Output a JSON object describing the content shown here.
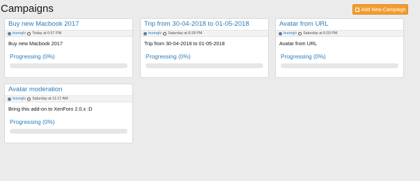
{
  "page": {
    "title": "Campaigns",
    "add_button_label": "Add New Campaign"
  },
  "campaigns": [
    {
      "title": "Buy new Macbook 2017",
      "user": "truonglv",
      "time": "Today at 6:57 PM",
      "description": "Buy new Macbook 2017",
      "progress_label": "Progressing (0%)",
      "progress": 0
    },
    {
      "title": "Trip from 30-04-2018 to 01-05-2018",
      "user": "truonglv",
      "time": "Saturday at 8:28 PM",
      "description": "Trip from 30-04-2018 to 01-05-2018",
      "progress_label": "Progressing (0%)",
      "progress": 0
    },
    {
      "title": "Avatar from URL",
      "user": "truonglv",
      "time": "Saturday at 6:03 PM",
      "description": "Avatar from URL",
      "progress_label": "Progressing (0%)",
      "progress": 0
    },
    {
      "title": "Avatar moderation",
      "user": "truonglv",
      "time": "Saturday at 11:17 AM",
      "description": "Bring this add-on to XenForo 2.0.x :D",
      "progress_label": "Progressing (0%)",
      "progress": 0
    }
  ],
  "colors": {
    "accent": "#2b7bb9",
    "button": "#f39c30",
    "background": "#ebebeb"
  }
}
